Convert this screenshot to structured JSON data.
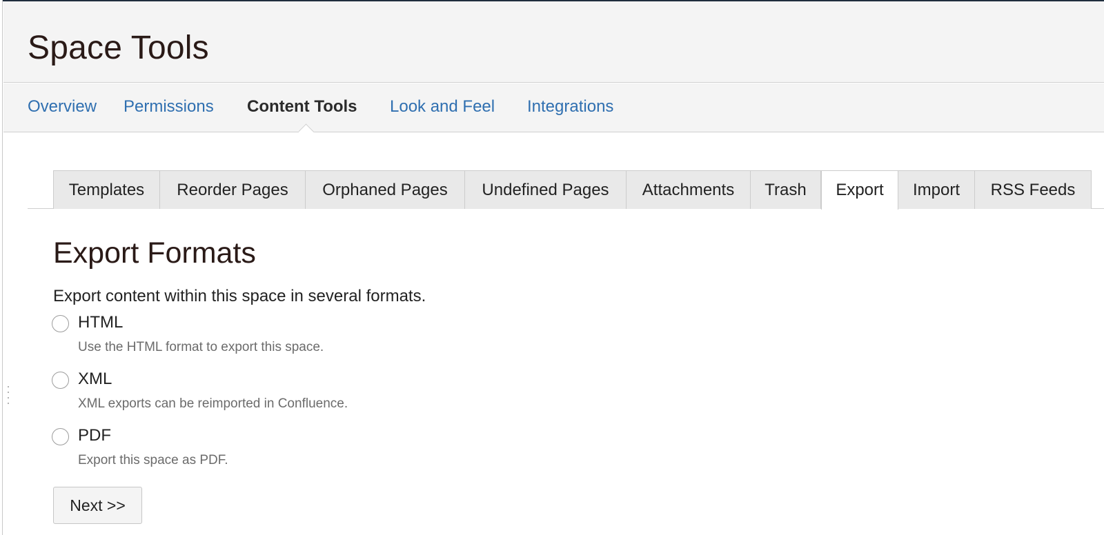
{
  "header": {
    "title": "Space Tools"
  },
  "nav": {
    "items": [
      {
        "label": "Overview"
      },
      {
        "label": "Permissions"
      },
      {
        "label": "Content Tools"
      },
      {
        "label": "Look and Feel"
      },
      {
        "label": "Integrations"
      }
    ],
    "active": "Content Tools"
  },
  "tabs": {
    "items": [
      {
        "label": "Templates"
      },
      {
        "label": "Reorder Pages"
      },
      {
        "label": "Orphaned Pages"
      },
      {
        "label": "Undefined Pages"
      },
      {
        "label": "Attachments"
      },
      {
        "label": "Trash"
      },
      {
        "label": "Export"
      },
      {
        "label": "Import"
      },
      {
        "label": "RSS Feeds"
      }
    ],
    "active": "Export"
  },
  "main": {
    "title": "Export Formats",
    "intro": "Export content within this space in several formats.",
    "options": [
      {
        "label": "HTML",
        "description": "Use the HTML format to export this space.",
        "selected": false
      },
      {
        "label": "XML",
        "description": "XML exports can be reimported in Confluence.",
        "selected": false
      },
      {
        "label": "PDF",
        "description": "Export this space as PDF.",
        "selected": false
      }
    ],
    "next_label": "Next >>"
  },
  "colors": {
    "link": "#2f6fb0",
    "title": "#2a1a17",
    "header_bg": "#f4f4f4"
  }
}
